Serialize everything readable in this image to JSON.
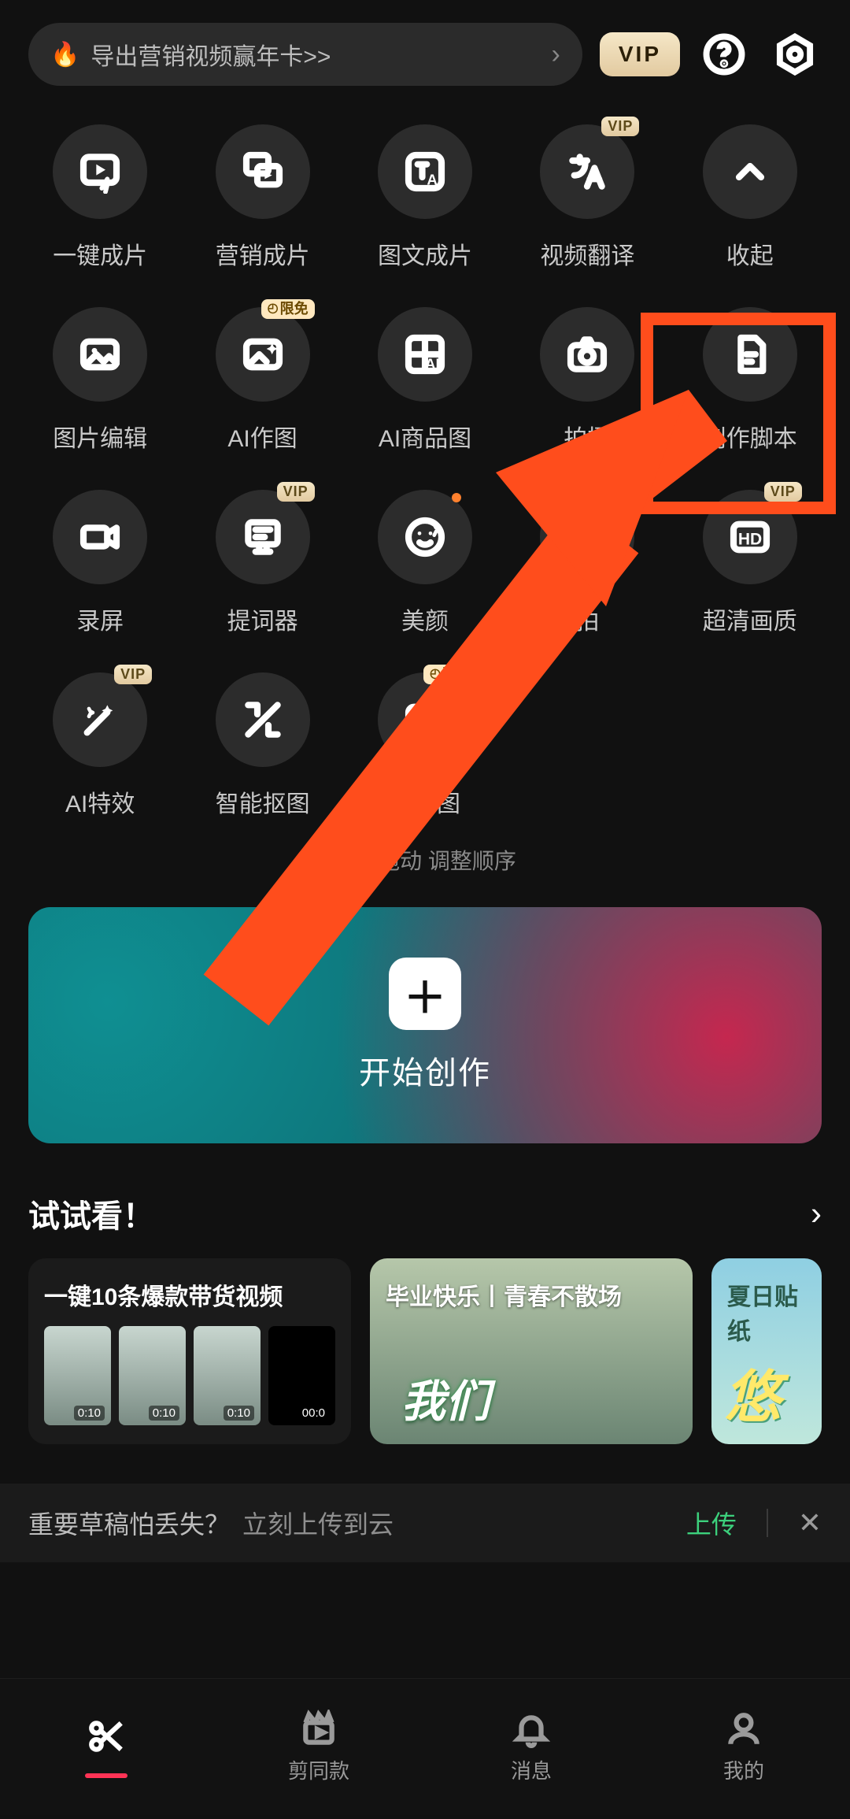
{
  "topbar": {
    "promo_text": "导出营销视频赢年卡>>",
    "vip_label": "VIP"
  },
  "badges": {
    "vip": "VIP",
    "limited_free": "限免"
  },
  "tools": [
    {
      "id": "one-click-clip",
      "label": "一键成片",
      "icon": "play-bolt",
      "badge": null
    },
    {
      "id": "marketing-clip",
      "label": "营销成片",
      "icon": "dup-play",
      "badge": null
    },
    {
      "id": "image-text-clip",
      "label": "图文成片",
      "icon": "t-ai",
      "badge": null
    },
    {
      "id": "video-translate",
      "label": "视频翻译",
      "icon": "translate",
      "badge": "vip"
    },
    {
      "id": "collapse",
      "label": "收起",
      "icon": "chev-up",
      "badge": null
    },
    {
      "id": "photo-edit",
      "label": "图片编辑",
      "icon": "image",
      "badge": null
    },
    {
      "id": "ai-draw",
      "label": "AI作图",
      "icon": "image-ai",
      "badge": "limited_free"
    },
    {
      "id": "ai-product-img",
      "label": "AI商品图",
      "icon": "grid-ai",
      "badge": null
    },
    {
      "id": "shoot",
      "label": "拍摄",
      "icon": "camera",
      "badge": null
    },
    {
      "id": "create-script",
      "label": "创作脚本",
      "icon": "file",
      "badge": null
    },
    {
      "id": "screen-record",
      "label": "录屏",
      "icon": "cam",
      "badge": null
    },
    {
      "id": "teleprompter",
      "label": "提词器",
      "icon": "prompter",
      "badge": "vip"
    },
    {
      "id": "beauty",
      "label": "美颜",
      "icon": "face",
      "badge": null,
      "dot": true
    },
    {
      "id": "virtual-shoot",
      "label": "拍",
      "icon": "smiley",
      "badge": null
    },
    {
      "id": "hd-quality",
      "label": "超清画质",
      "icon": "hd",
      "badge": "vip"
    },
    {
      "id": "ai-fx",
      "label": "AI特效",
      "icon": "wand",
      "badge": "vip"
    },
    {
      "id": "smart-cutout",
      "label": "智能抠图",
      "icon": "cutout",
      "badge": null
    },
    {
      "id": "hd-image",
      "label": "超清图",
      "icon": "img-hd",
      "badge": "limited_free"
    }
  ],
  "reorder_hint": "长按拖动  调整顺序",
  "create": {
    "label": "开始创作"
  },
  "tryit": {
    "title": "试试看！",
    "cards": [
      {
        "title": "一键10条爆款带货视频",
        "thumbs": [
          "0:10",
          "0:10",
          "0:10",
          "00:0"
        ],
        "calligraphy": ""
      },
      {
        "title": "毕业快乐丨青春不散场",
        "calligraphy": "我们"
      },
      {
        "title": "夏日贴纸",
        "calligraphy": "悠"
      }
    ]
  },
  "cloudbar": {
    "question": "重要草稿怕丢失？",
    "answer": "立刻上传到云",
    "upload_label": "上传"
  },
  "nav": [
    {
      "id": "edit",
      "label": "",
      "icon": "scissors",
      "active": true
    },
    {
      "id": "template",
      "label": "剪同款",
      "icon": "clap"
    },
    {
      "id": "msg",
      "label": "消息",
      "icon": "bell"
    },
    {
      "id": "me",
      "label": "我的",
      "icon": "user"
    }
  ]
}
